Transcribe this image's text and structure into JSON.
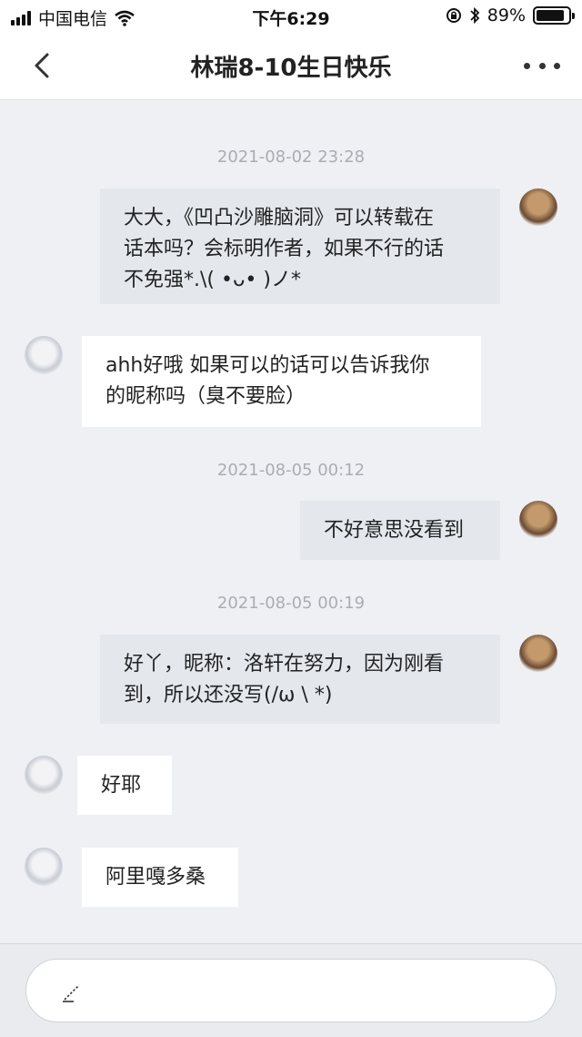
{
  "status_bar": {
    "carrier": "中国电信",
    "time": "下午6:29",
    "battery_percent": "89%",
    "battery_level": 0.89
  },
  "nav": {
    "title": "林瑞8-10生日快乐",
    "back_icon": "chevron-left-icon",
    "more_icon": "more-dots-icon"
  },
  "messages": [
    {
      "type": "timestamp",
      "text": "2021-08-02 23:28"
    },
    {
      "type": "outgoing",
      "text": "大大，《凹凸沙雕脑洞》可以转载在\n话本吗？会标明作者，如果不行的话\n不免强*.\\( •ᴗ• )ノ*"
    },
    {
      "type": "incoming",
      "text": "ahh好哦 如果可以的话可以告诉我你\n的昵称吗（臭不要脸）"
    },
    {
      "type": "timestamp",
      "text": "2021-08-05 00:12"
    },
    {
      "type": "outgoing",
      "text": "不好意思没看到"
    },
    {
      "type": "timestamp",
      "text": "2021-08-05 00:19"
    },
    {
      "type": "outgoing",
      "text": "好丫，昵称：洛轩在努力，因为刚看\n到，所以还没写(/ω \\ *)"
    },
    {
      "type": "incoming",
      "text": "好耶"
    },
    {
      "type": "incoming",
      "text": "阿里嘎多桑"
    }
  ],
  "input": {
    "placeholder": "",
    "icon": "pen-icon"
  },
  "colors": {
    "background": "#eef0f3",
    "outgoing_bubble": "#e4e8ed",
    "incoming_bubble": "#ffffff",
    "timestamp_text": "#a9adb3"
  }
}
